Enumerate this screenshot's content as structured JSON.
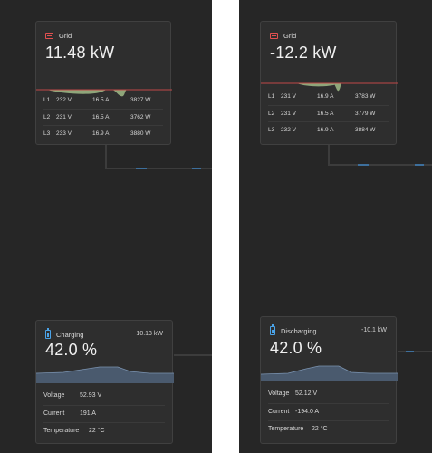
{
  "panels": [
    {
      "grid": {
        "title": "Grid",
        "power": "11.48 kW",
        "phases": [
          {
            "label": "L1",
            "voltage": "232 V",
            "current": "16.5 A",
            "power": "3827 W"
          },
          {
            "label": "L2",
            "voltage": "231 V",
            "current": "16.5 A",
            "power": "3762 W"
          },
          {
            "label": "L3",
            "voltage": "233 V",
            "current": "16.9 A",
            "power": "3880 W"
          }
        ]
      },
      "battery": {
        "state": "Charging",
        "power": "10.13 kW",
        "soc": "42.0 %",
        "rows": [
          {
            "label": "Voltage",
            "value": "52.93 V"
          },
          {
            "label": "Current",
            "value": "191 A"
          },
          {
            "label": "Temperature",
            "value": "22 °C"
          }
        ]
      }
    },
    {
      "grid": {
        "title": "Grid",
        "power": "-12.2 kW",
        "phases": [
          {
            "label": "L1",
            "voltage": "231 V",
            "current": "16.9 A",
            "power": "3783 W"
          },
          {
            "label": "L2",
            "voltage": "231 V",
            "current": "16.5 A",
            "power": "3779 W"
          },
          {
            "label": "L3",
            "voltage": "232 V",
            "current": "16.9 A",
            "power": "3884 W"
          }
        ]
      },
      "battery": {
        "state": "Discharging",
        "power": "-10.1 kW",
        "soc": "42.0 %",
        "rows": [
          {
            "label": "Voltage",
            "value": "52.12 V"
          },
          {
            "label": "Current",
            "value": "-194.0 A"
          },
          {
            "label": "Temperature",
            "value": "22 °C"
          }
        ]
      }
    }
  ],
  "colors": {
    "background": "#262626",
    "card": "#2e2e2e",
    "grid_accent": "#e25050",
    "battery_accent": "#4aa3e8",
    "grid_sparkline_fill": "#8fa67a",
    "battery_sparkline_fill": "#4a5a6e"
  },
  "icons": {
    "grid": "grid-icon",
    "battery": "battery-icon"
  }
}
